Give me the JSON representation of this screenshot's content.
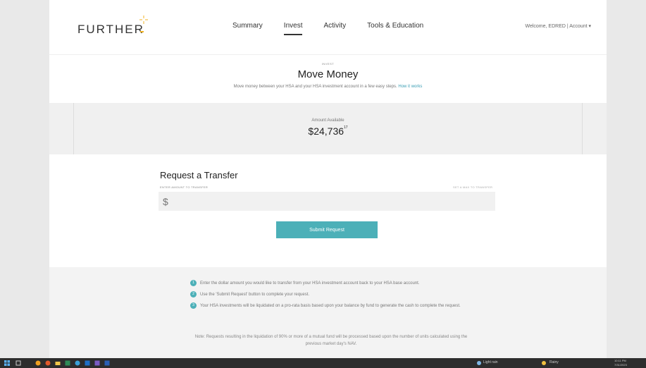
{
  "header": {
    "logo": "FURTHER",
    "nav": [
      "Summary",
      "Invest",
      "Activity",
      "Tools & Education"
    ],
    "active_nav": "Invest",
    "welcome": "Welcome, EDRED | Account ▾"
  },
  "main": {
    "eyebrow": "INVEST",
    "title": "Move Money",
    "subtitle": "Move money between your HSA and your HSA investment account in a few easy steps.",
    "subtitle_link": "How it works"
  },
  "available": {
    "label": "Amount Available",
    "amount": "$24,736",
    "cents": "17"
  },
  "transfer": {
    "title": "Request a Transfer",
    "amount_label": "ENTER AMOUNT TO TRANSFER",
    "max_label": "SET A MAX TO TRANSFER",
    "amount_placeholder": "$",
    "submit_label": "Submit Request"
  },
  "info": {
    "steps": [
      {
        "num": "1",
        "text": "Enter the dollar amount you would like to transfer from your HSA investment account back to your HSA base account."
      },
      {
        "num": "2",
        "text": "Use the 'Submit Request' button to complete your request."
      },
      {
        "num": "3",
        "text": "Your HSA investments will be liquidated on a pro-rata basis based upon your balance by fund to generate the cash to complete the request."
      }
    ],
    "note": "Note: Requests resulting in the liquidation of 90% or more of a mutual fund will be processed based upon the number of units calculated using the previous market day's NAV."
  },
  "taskbar": {
    "weather": "Light rain",
    "status": "Rainy",
    "time": "10:11 PM",
    "date": "7/31/2023"
  },
  "colors": {
    "accent": "#4cb0b8",
    "logo_star": "#f0b323",
    "taskbar": "#2d2d2d"
  }
}
